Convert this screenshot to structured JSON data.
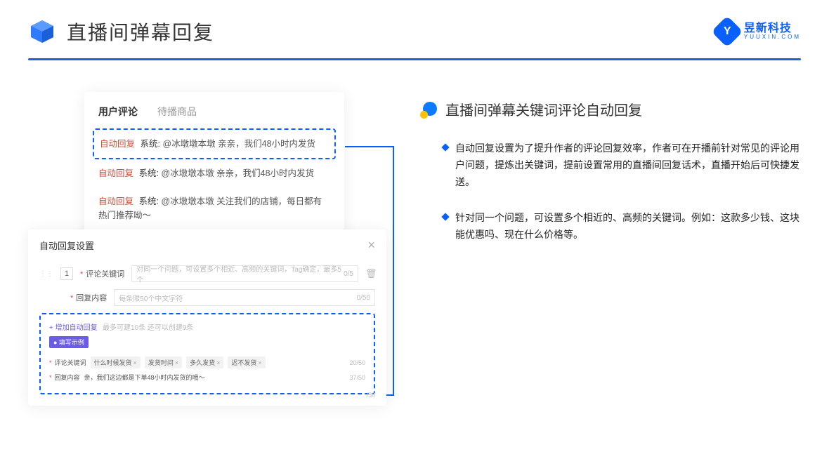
{
  "header": {
    "title": "直播间弹幕回复",
    "brand_name": "昱新科技",
    "brand_url": "YUUXIN.COM"
  },
  "comments": {
    "tab_active": "用户评论",
    "tab_other": "待播商品",
    "items": [
      {
        "tag": "自动回复",
        "sys": "系统:",
        "text": "@冰墩墩本墩 亲亲，我们48小时内发货"
      },
      {
        "tag": "自动回复",
        "sys": "系统:",
        "text": "@冰墩墩本墩 亲亲，我们48小时内发货"
      },
      {
        "tag": "自动回复",
        "sys": "系统:",
        "text": "@冰墩墩本墩 关注我们的店铺，每日都有热门推荐呦～"
      }
    ]
  },
  "settings": {
    "title": "自动回复设置",
    "idx": "1",
    "kw_label": "评论关键词",
    "kw_placeholder": "对同一个问题，可设置多个相近、高频的关键词，Tag确定，最多5个",
    "kw_counter": "0/5",
    "content_label": "回复内容",
    "content_placeholder": "每条限50个中文字符",
    "content_counter": "0/50",
    "add_link": "+ 增加自动回复",
    "add_hint": "最多可建10条 还可以创建9条",
    "example_badge": "● 填写示例",
    "ex_kw_label": "评论关键词",
    "ex_tags": [
      "什么时候发货",
      "发货时间",
      "多久发货",
      "迟不发货"
    ],
    "ex_kw_counter": "20/50",
    "ex_content_label": "回复内容",
    "ex_content_text": "亲，我们这边都是下单48小时内发货的哦～",
    "ex_content_counter": "37/50",
    "stray_counter": "/50"
  },
  "right": {
    "section_title": "直播间弹幕关键词评论自动回复",
    "bullets": [
      "自动回复设置为了提升作者的评论回复效率，作者可在开播前针对常见的评论用户问题，提炼出关键词，提前设置常用的直播间回复话术，直播开始后可快捷发送。",
      "针对同一个问题，可设置多个相近的、高频的关键词。例如：这款多少钱、这块能优惠吗、现在什么价格等。"
    ]
  }
}
